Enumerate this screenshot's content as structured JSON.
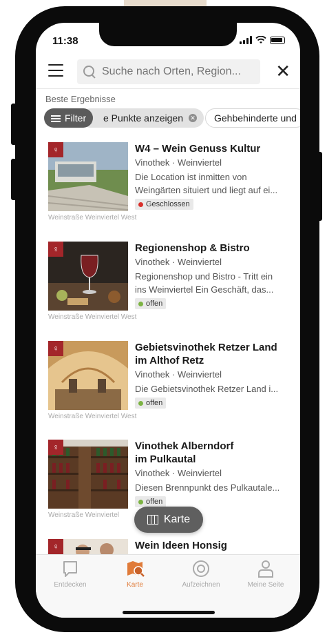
{
  "status_bar": {
    "time": "11:38"
  },
  "header": {
    "search_placeholder": "Suche nach Orten, Region..."
  },
  "results": {
    "section_label": "Beste Ergebnisse",
    "filter_label": "Filter",
    "chips": [
      {
        "label": "e Punkte anzeigen"
      },
      {
        "label": "Gehbehinderte und"
      }
    ]
  },
  "items": [
    {
      "title_line1": "W4 – Wein Genuss Kultur",
      "title_line2": "",
      "meta": "Vinothek · Weinviertel",
      "desc_line1": "Die Location ist inmitten von",
      "desc_line2": "Weingärten situiert und liegt auf ei...",
      "status": "Geschlossen",
      "status_color": "#d9302b",
      "route": "Weinstraße Weinviertel West"
    },
    {
      "title_line1": "Regionenshop & Bistro",
      "title_line2": "",
      "meta": "Vinothek · Weinviertel",
      "desc_line1": "Regionenshop und Bistro - Tritt ein",
      "desc_line2": "ins Weinviertel Ein Geschäft, das...",
      "status": "offen",
      "status_color": "#7cb342",
      "route": "Weinstraße Weinviertel West"
    },
    {
      "title_line1": "Gebietsvinothek Retzer Land",
      "title_line2": "im Althof Retz",
      "meta": "Vinothek · Weinviertel",
      "desc_line1": "Die Gebietsvinothek Retzer Land i...",
      "desc_line2": "",
      "status": "offen",
      "status_color": "#7cb342",
      "route": "Weinstraße Weinviertel West"
    },
    {
      "title_line1": "Vinothek Alberndorf",
      "title_line2": "im Pulkautal",
      "meta": "Vinothek · Weinviertel",
      "desc_line1": "Diesen Brennpunkt des Pulkautale...",
      "desc_line2": "",
      "status": "offen",
      "status_color": "#7cb342",
      "route": "Weinstraße Weinviertel"
    },
    {
      "title_line1": "Wein Ideen Honsig",
      "title_line2": "",
      "meta": "",
      "desc_line1": "",
      "desc_line2": "",
      "status": "",
      "status_color": "#7cb342",
      "route": ""
    }
  ],
  "map_button": {
    "label": "Karte"
  },
  "tabbar": {
    "tabs": [
      {
        "label": "Entdecken",
        "icon": "speech-bubble-icon"
      },
      {
        "label": "Karte",
        "icon": "map-pin-icon",
        "active": true
      },
      {
        "label": "Aufzeichnen",
        "icon": "record-icon"
      },
      {
        "label": "Meine Seite",
        "icon": "person-icon"
      }
    ]
  },
  "colors": {
    "accent": "#e07b39",
    "badge": "#a3262a",
    "closed": "#d9302b",
    "open": "#7cb342"
  }
}
